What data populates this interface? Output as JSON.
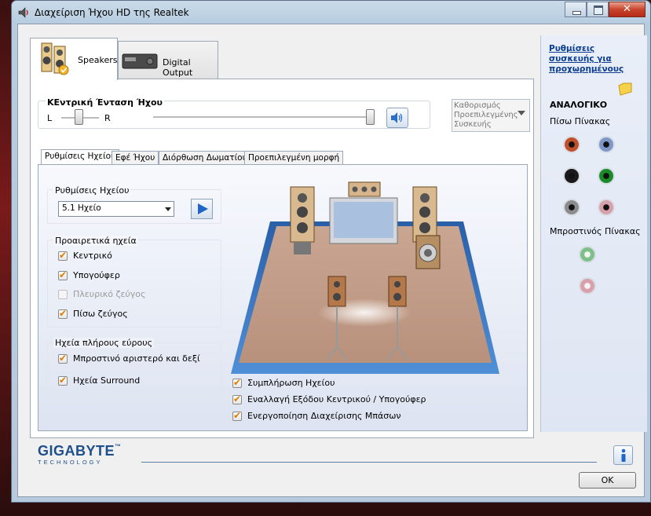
{
  "window": {
    "title": "Διαχείριση Ήχου HD της Realtek"
  },
  "tabs": [
    {
      "label": "Speakers"
    },
    {
      "label": "Digital Output"
    }
  ],
  "volume": {
    "title": "ΚΕντρική Ένταση Ήχου",
    "left": "L",
    "right": "R",
    "main_level": 1.0,
    "balance": 0.5
  },
  "default_device": {
    "label": "Καθορισμός Προεπιλεγμένης Συσκευής"
  },
  "inner_tabs": [
    {
      "label": "Ρυθμίσεις Ηχείου"
    },
    {
      "label": "Εφέ Ήχου"
    },
    {
      "label": "Διόρθωση Δωματίου"
    },
    {
      "label": "Προεπιλεγμένη μορφή"
    }
  ],
  "speaker_config": {
    "title": "Ρυθμίσεις Ηχείου",
    "selected": "5.1 Ηχείο"
  },
  "optional_speakers": {
    "title": "Προαιρετικά ηχεία",
    "items": [
      {
        "label": "Κεντρικό",
        "checked": true,
        "enabled": true
      },
      {
        "label": "Υπογούφερ",
        "checked": true,
        "enabled": true
      },
      {
        "label": "Πλευρικό ζεύγος",
        "checked": false,
        "enabled": false
      },
      {
        "label": "Πίσω ζεύγος",
        "checked": true,
        "enabled": true
      }
    ]
  },
  "fullrange": {
    "title": "Ηχεία πλήρους εύρους",
    "items": [
      {
        "label": "Μπροστινό αριστερό και δεξί",
        "checked": true
      },
      {
        "label": "Ηχεία Surround",
        "checked": true
      }
    ]
  },
  "options": [
    {
      "label": "Συμπλήρωση Ηχείου",
      "checked": true
    },
    {
      "label": "Εναλλαγή Εξόδου Κεντρικού / Υπογούφερ",
      "checked": true
    },
    {
      "label": "Ενεργοποίηση Διαχείρισης Μπάσων",
      "checked": true
    }
  ],
  "right_panel": {
    "link": "Ρυθμίσεις συσκευής για προχωρημένους",
    "analog": "ΑΝΑΛΟΓΙΚΟ",
    "back": "Πίσω Πίνακας",
    "front": "Μπροστινός Πίνακας",
    "back_jacks": [
      "#c0502a",
      "#7f97c8",
      "#1a1a1a",
      "#1a8a2a",
      "#8c8c8c",
      "#d8a0aa"
    ],
    "front_jacks": [
      "#7fc08a",
      "#d8a0aa"
    ]
  },
  "brand": {
    "name": "GIGABYTE",
    "sub": "TECHNOLOGY",
    "tm": "™"
  },
  "ok_button": "OK"
}
